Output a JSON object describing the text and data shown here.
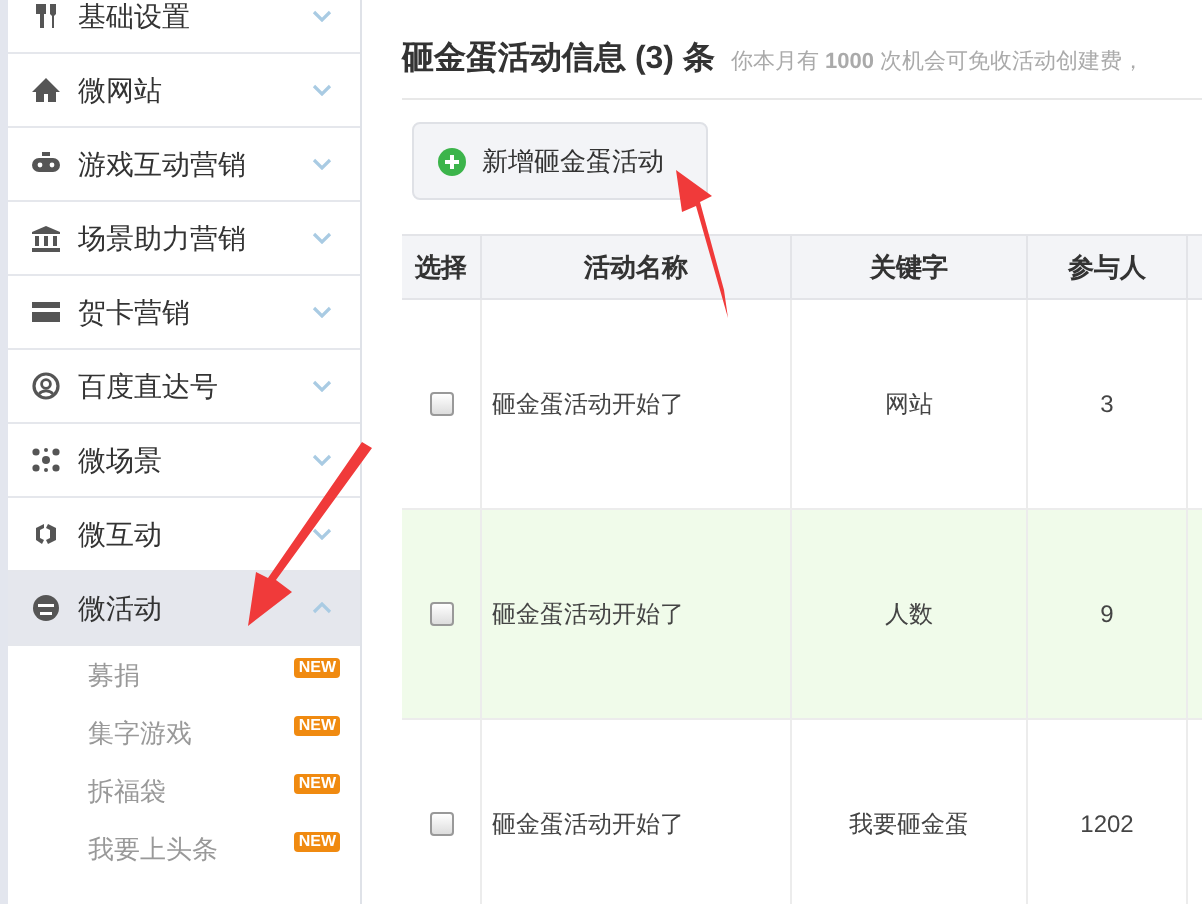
{
  "sidebar": {
    "items": [
      {
        "label": "基础设置",
        "expanded": false,
        "selected": false
      },
      {
        "label": "微网站",
        "expanded": false,
        "selected": false
      },
      {
        "label": "游戏互动营销",
        "expanded": false,
        "selected": false
      },
      {
        "label": "场景助力营销",
        "expanded": false,
        "selected": false
      },
      {
        "label": "贺卡营销",
        "expanded": false,
        "selected": false
      },
      {
        "label": "百度直达号",
        "expanded": false,
        "selected": false
      },
      {
        "label": "微场景",
        "expanded": false,
        "selected": false
      },
      {
        "label": "微互动",
        "expanded": false,
        "selected": false
      },
      {
        "label": "微活动",
        "expanded": true,
        "selected": true,
        "children": [
          {
            "label": "募捐",
            "badge": "NEW"
          },
          {
            "label": "集字游戏",
            "badge": "NEW"
          },
          {
            "label": "拆福袋",
            "badge": "NEW"
          },
          {
            "label": "我要上头条",
            "badge": "NEW"
          }
        ]
      }
    ]
  },
  "header": {
    "title": "砸金蛋活动信息 (3) 条",
    "note": "你本月有 **1000** 次机会可免收活动创建费，"
  },
  "add_button": {
    "label": "新增砸金蛋活动"
  },
  "table": {
    "columns": [
      "选择",
      "活动名称",
      "关键字",
      "参与人"
    ],
    "rows": [
      {
        "checked": false,
        "highlighted": false,
        "name": "砸金蛋活动开始了",
        "keyword": "网站",
        "participants": "3"
      },
      {
        "checked": false,
        "highlighted": true,
        "name": "砸金蛋活动开始了",
        "keyword": "人数",
        "participants": "9"
      },
      {
        "checked": false,
        "highlighted": false,
        "name": "砸金蛋活动开始了",
        "keyword": "我要砸金蛋",
        "participants": "1202"
      }
    ]
  }
}
